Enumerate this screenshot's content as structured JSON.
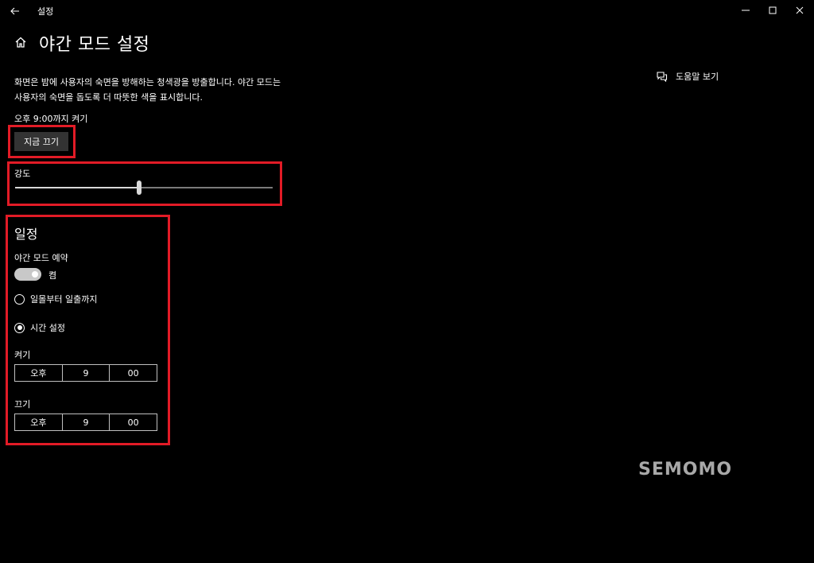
{
  "window": {
    "title": "설정"
  },
  "header": {
    "title": "야간 모드 설정",
    "help_link": "도움말 보기"
  },
  "description": "화면은 밤에 사용자의 숙면을 방해하는 청색광을 방출합니다. 야간 모드는 사용자의 숙면을 돕도록 더 따뜻한 색을 표시합니다.",
  "status": {
    "text": "오후 9:00까지 켜기",
    "turn_off_button": "지금 끄기"
  },
  "strength": {
    "label": "강도",
    "value_fraction": 0.48
  },
  "schedule": {
    "title": "일정",
    "schedule_label": "야간 모드 예약",
    "toggle_state": "켬",
    "toggle_on": true,
    "options": [
      {
        "label": "일몰부터 일출까지",
        "selected": false
      },
      {
        "label": "시간 설정",
        "selected": true
      }
    ],
    "turn_on": {
      "label": "켜기",
      "ampm": "오후",
      "hour": "9",
      "minute": "00"
    },
    "turn_off": {
      "label": "끄기",
      "ampm": "오후",
      "hour": "9",
      "minute": "00"
    }
  },
  "watermark": "SEMOMO",
  "colors": {
    "background": "#000000",
    "highlight": "#e21b26",
    "button": "#333333"
  },
  "icons": [
    "back-arrow-icon",
    "minimize-icon",
    "maximize-icon",
    "close-icon",
    "home-icon",
    "help-chat-icon"
  ]
}
